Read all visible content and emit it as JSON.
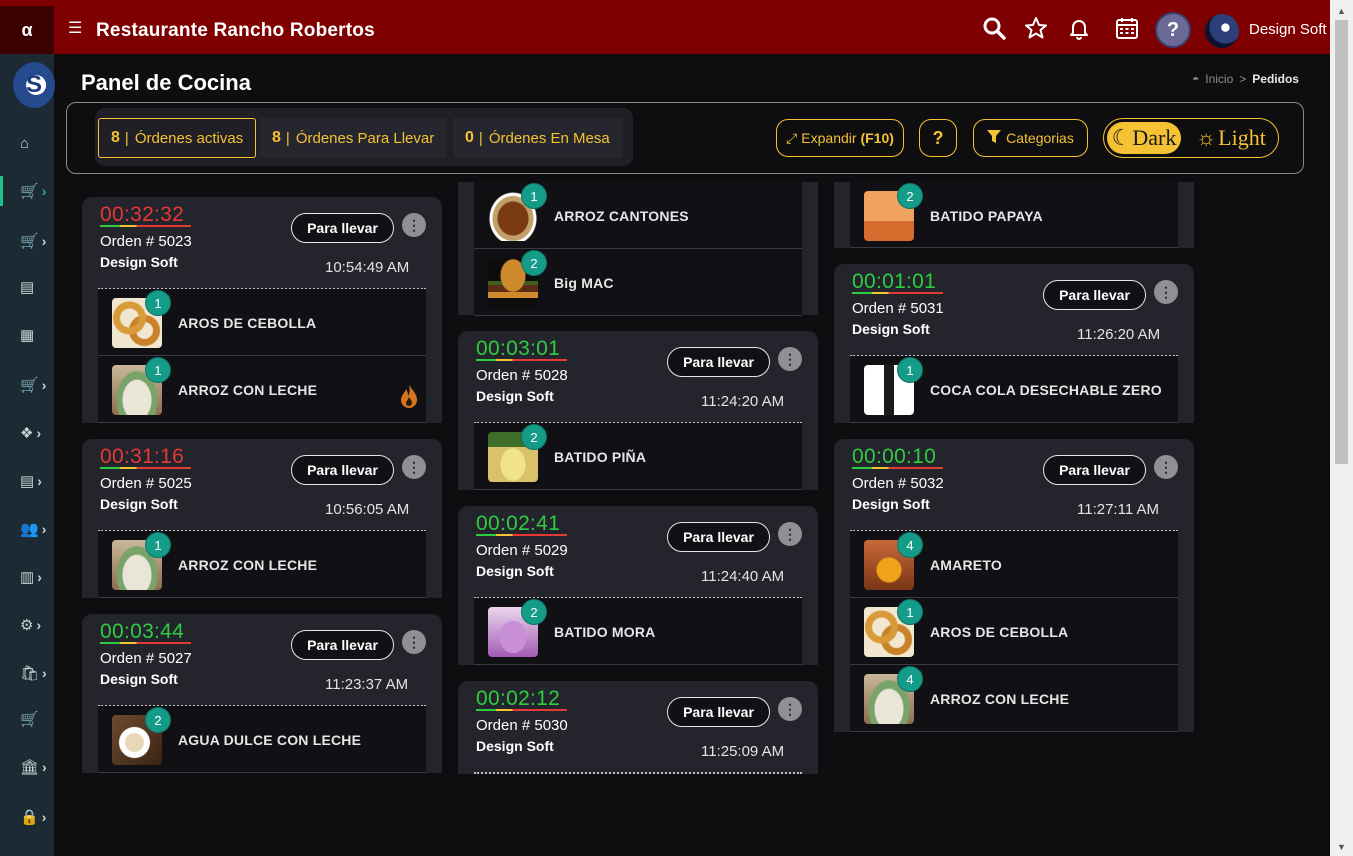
{
  "app": {
    "logo_letter": "α",
    "title": "Restaurante Rancho Robertos",
    "user_name": "Design Soft",
    "help_label": "?"
  },
  "sidebar_logo_letter": "S",
  "page": {
    "title": "Panel de Cocina",
    "breadcrumb": {
      "home": "Inicio",
      "separator": ">",
      "current": "Pedidos"
    }
  },
  "tabs": [
    {
      "count": "8",
      "label": "Órdenes activas"
    },
    {
      "count": "8",
      "label": "Órdenes Para Llevar"
    },
    {
      "count": "0",
      "label": "Órdenes En Mesa"
    }
  ],
  "toolbar": {
    "expand_label": "Expandir",
    "expand_key": "(F10)",
    "help_label": "?",
    "categories_label": "Categorias",
    "dark_label": "Dark",
    "light_label": "Light"
  },
  "orders": [
    {
      "timer": "00:32:32",
      "timer_state": "late",
      "order": "Orden # 5023",
      "user": "Design Soft",
      "time": "10:54:49 AM",
      "type": "Para llevar",
      "items": [
        {
          "qty": "1",
          "name": "AROS DE CEBOLLA",
          "img": "rings"
        },
        {
          "qty": "1",
          "name": "ARROZ CON LECHE",
          "img": "rice",
          "flame": true
        }
      ]
    },
    {
      "timer": "00:31:16",
      "timer_state": "late",
      "order": "Orden # 5025",
      "user": "Design Soft",
      "time": "10:56:05 AM",
      "type": "Para llevar",
      "items": [
        {
          "qty": "1",
          "name": "ARROZ CON LECHE",
          "img": "rice"
        }
      ]
    },
    {
      "timer": "00:03:44",
      "timer_state": "ok",
      "order": "Orden # 5027",
      "user": "Design Soft",
      "time": "11:23:37 AM",
      "type": "Para llevar",
      "items": [
        {
          "qty": "2",
          "name": "AGUA DULCE CON LECHE",
          "img": "coffee"
        }
      ]
    },
    {
      "partial": true,
      "items": [
        {
          "qty": "1",
          "name": "ARROZ CANTONES",
          "img": "noodle"
        },
        {
          "qty": "2",
          "name": "Big MAC",
          "img": "burger"
        }
      ]
    },
    {
      "timer": "00:03:01",
      "timer_state": "ok",
      "order": "Orden # 5028",
      "user": "Design Soft",
      "time": "11:24:20 AM",
      "type": "Para llevar",
      "items": [
        {
          "qty": "2",
          "name": "BATIDO PIÑA",
          "img": "pina"
        }
      ]
    },
    {
      "timer": "00:02:41",
      "timer_state": "ok",
      "order": "Orden # 5029",
      "user": "Design Soft",
      "time": "11:24:40 AM",
      "type": "Para llevar",
      "items": [
        {
          "qty": "2",
          "name": "BATIDO MORA",
          "img": "mora"
        }
      ]
    },
    {
      "timer": "00:02:12",
      "timer_state": "ok",
      "order": "Orden # 5030",
      "user": "Design Soft",
      "time": "11:25:09 AM",
      "type": "Para llevar",
      "items": []
    },
    {
      "partial": true,
      "items": [
        {
          "qty": "2",
          "name": "BATIDO PAPAYA",
          "img": "papaya"
        }
      ]
    },
    {
      "timer": "00:01:01",
      "timer_state": "ok",
      "order": "Orden # 5031",
      "user": "Design Soft",
      "time": "11:26:20 AM",
      "type": "Para llevar",
      "items": [
        {
          "qty": "1",
          "name": "COCA COLA DESECHABLE ZERO",
          "img": "coke"
        }
      ]
    },
    {
      "timer": "00:00:10",
      "timer_state": "ok",
      "order": "Orden # 5032",
      "user": "Design Soft",
      "time": "11:27:11 AM",
      "type": "Para llevar",
      "items": [
        {
          "qty": "4",
          "name": "AMARETO",
          "img": "amaretto"
        },
        {
          "qty": "1",
          "name": "AROS DE CEBOLLA",
          "img": "rings"
        },
        {
          "qty": "4",
          "name": "ARROZ CON LECHE",
          "img": "rice"
        }
      ]
    }
  ],
  "colors": {
    "topbar": "#7f0000",
    "accent": "#f4c233",
    "late": "#e53935",
    "ok": "#2ecc40",
    "badge": "#149c88"
  }
}
